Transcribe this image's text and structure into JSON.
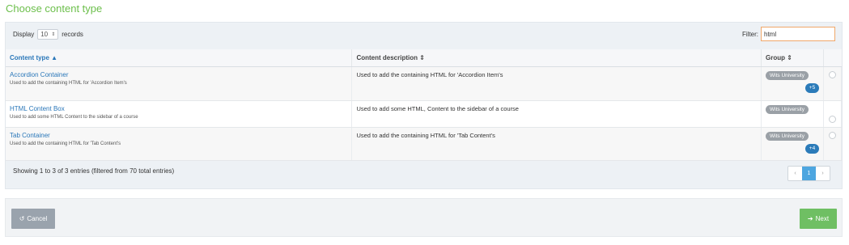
{
  "page": {
    "title": "Choose content type"
  },
  "controls": {
    "display_label": "Display",
    "records_value": "10",
    "records_label": "records",
    "filter_label": "Filter:",
    "filter_value": "html"
  },
  "table": {
    "columns": [
      "Content type",
      "Content description",
      "Group"
    ],
    "rows": [
      {
        "name": "Accordion Container",
        "subtitle": "Used to add the containing HTML for 'Accordion Item's",
        "description": "Used to add the containing HTML for 'Accordion Item's",
        "group": "Wits University",
        "extra": "+5"
      },
      {
        "name": "HTML Content Box",
        "subtitle": "Used to add some HTML Content to the sidebar of a course",
        "description": "Used to add some HTML, Content to the sidebar of a course",
        "group": "Wits University",
        "extra": ""
      },
      {
        "name": "Tab Container",
        "subtitle": "Used to add the containing HTML for 'Tab Content's",
        "description": "Used to add the containing HTML for 'Tab Content's",
        "group": "Wits University",
        "extra": "+4"
      }
    ]
  },
  "info": "Showing 1 to 3 of 3 entries (filtered from 70 total entries)",
  "pagination": {
    "prev": "‹",
    "page": "1",
    "next": "›"
  },
  "buttons": {
    "cancel": "Cancel",
    "next": "Next"
  },
  "icons": {
    "sort_asc": "caret-up",
    "sort_both": "sort-arrows",
    "cancel": "undo-icon",
    "next": "arrow-right-icon"
  },
  "colors": {
    "title": "#6cbf4b",
    "link": "#2a77b9",
    "next_button": "#6fbf63",
    "cancel_button": "#9aa3ad",
    "badge": "#9aa0a6",
    "pill": "#2b7bb9"
  }
}
